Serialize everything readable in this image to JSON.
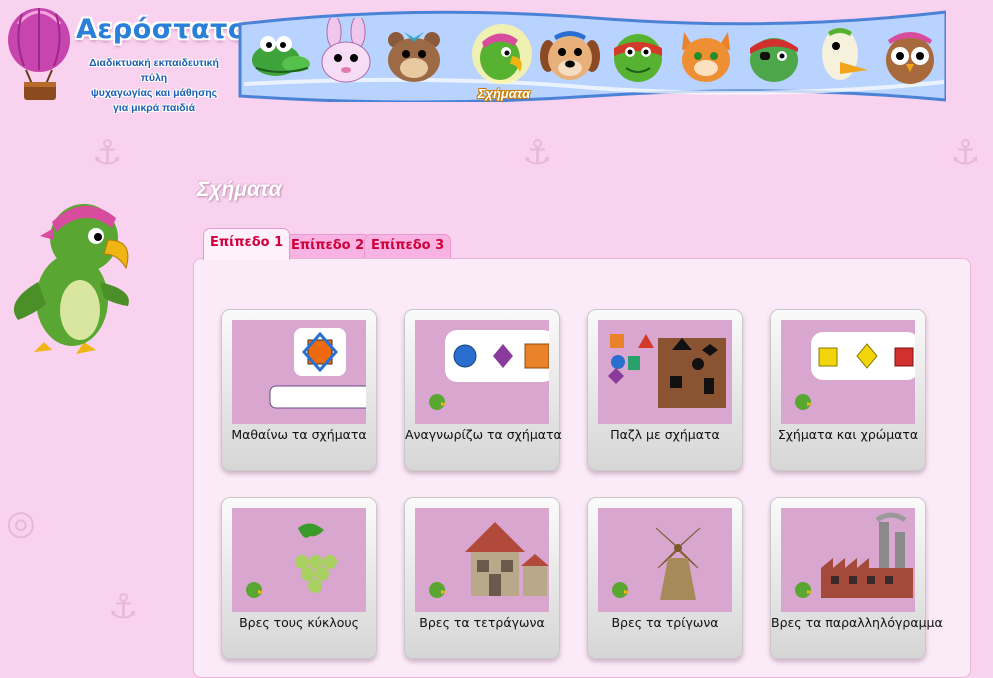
{
  "site": {
    "brand": "Αερόστατο",
    "tagline_lines": [
      "Διαδικτυακή εκπαιδευτική πύλη",
      "ψυχαγωγίας και μάθησης",
      "για μικρά παιδιά"
    ]
  },
  "nav": {
    "characters": [
      {
        "icon": "crocodile-icon"
      },
      {
        "icon": "bunny-icon"
      },
      {
        "icon": "hamster-icon"
      },
      {
        "icon": "parrot-icon",
        "active": true
      },
      {
        "icon": "dog-icon"
      },
      {
        "icon": "turtle-icon"
      },
      {
        "icon": "cat-icon"
      },
      {
        "icon": "pirate-turtle-icon"
      },
      {
        "icon": "duck-icon"
      },
      {
        "icon": "owl-icon"
      }
    ],
    "active_label": "Σχήματα"
  },
  "page": {
    "title": "Σχήματα"
  },
  "tabs": [
    {
      "label": "Επίπεδο 1",
      "active": true
    },
    {
      "label": "Επίπεδο 2",
      "active": false
    },
    {
      "label": "Επίπεδο 3",
      "active": false
    }
  ],
  "activities": [
    {
      "label": "Μαθαίνω τα σχήματα",
      "thumb": "learn-shapes"
    },
    {
      "label": "Αναγνωρίζω τα σχήματα",
      "thumb": "recognize-shapes"
    },
    {
      "label": "Παζλ με σχήματα",
      "thumb": "shape-puzzle"
    },
    {
      "label": "Σχήματα και χρώματα",
      "thumb": "shapes-colors"
    },
    {
      "label": "Βρες τους κύκλους",
      "thumb": "find-circles"
    },
    {
      "label": "Βρες τα τετράγωνα",
      "thumb": "find-squares"
    },
    {
      "label": "Βρες τα τρίγωνα",
      "thumb": "find-triangles"
    },
    {
      "label": "Βρες τα παραλληλόγραμμα",
      "thumb": "find-parallelograms"
    }
  ],
  "colors": {
    "background": "#f8d2ee",
    "tab_text": "#d0003a",
    "brand_blue": "#2a7fd9",
    "nav_band": "#b8d3ff"
  }
}
